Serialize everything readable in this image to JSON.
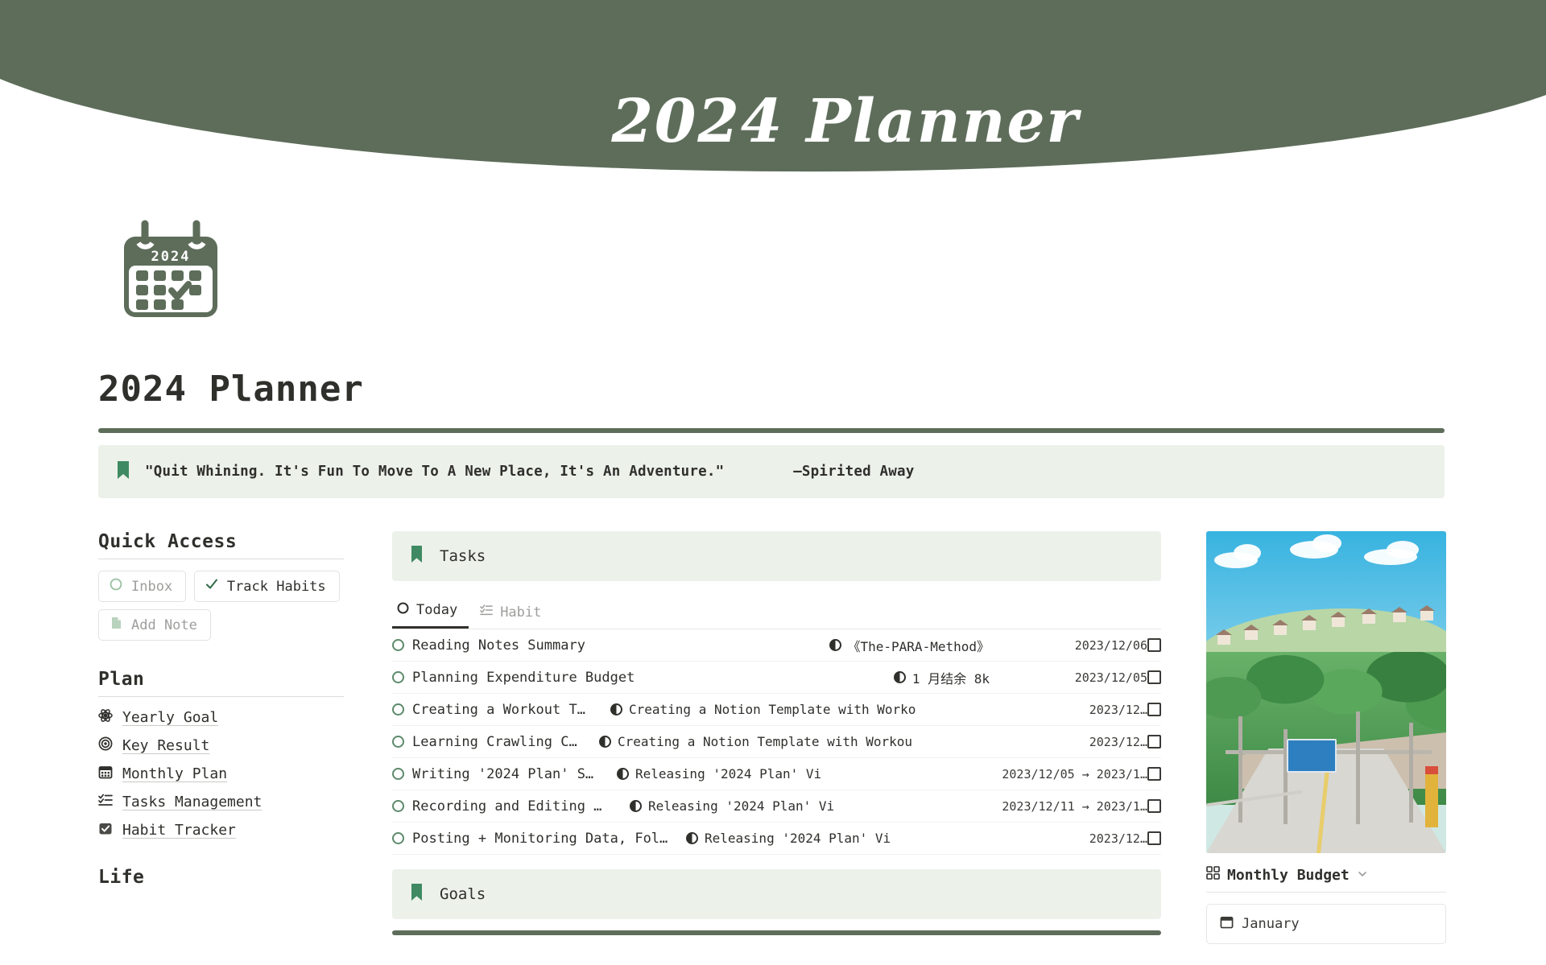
{
  "banner": {
    "title": "2024 Planner",
    "bg_color": "#5d6d5a"
  },
  "header": {
    "page_title": "2024 Planner",
    "calendar_icon_year": "2024"
  },
  "quote": {
    "text": "\"Quit Whining. It's Fun To Move To A New Place, It's An Adventure.\"        —Spirited Away",
    "bg_color": "#ecf1ea"
  },
  "sidebar": {
    "quick_access": {
      "heading": "Quick Access",
      "items": [
        {
          "label": "Inbox",
          "icon": "circle-outline-icon",
          "state": "muted"
        },
        {
          "label": "Track Habits",
          "icon": "check-icon",
          "state": "strong"
        },
        {
          "label": "Add Note",
          "icon": "document-icon",
          "state": "muted"
        }
      ]
    },
    "plan": {
      "heading": "Plan",
      "items": [
        {
          "label": "Yearly Goal",
          "icon": "atom-icon"
        },
        {
          "label": "Key Result",
          "icon": "target-icon"
        },
        {
          "label": "Monthly Plan",
          "icon": "calendar-icon"
        },
        {
          "label": "Tasks Management",
          "icon": "checklist-icon"
        },
        {
          "label": "Habit Tracker",
          "icon": "checkbox-filled-icon"
        }
      ]
    },
    "life": {
      "heading": "Life"
    }
  },
  "tasks_panel": {
    "title": "Tasks",
    "icon": "bookmark-icon",
    "tabs": [
      {
        "label": "Today",
        "icon": "circle-outline-icon",
        "active": true
      },
      {
        "label": "Habit",
        "icon": "checklist-icon",
        "active": false
      }
    ],
    "rows": [
      {
        "name": "Reading Notes Summary",
        "related": "《The-PARA-Method》",
        "date": "2023/12/06"
      },
      {
        "name": "Planning Expenditure Budget",
        "related": "1 月结余 8k",
        "date": "2023/12/05"
      },
      {
        "name": "Creating a Workout T…",
        "related": "Creating a Notion Template with Worko",
        "date": "2023/12…"
      },
      {
        "name": "Learning Crawling C…",
        "related": "Creating a Notion Template with Workou",
        "date": "2023/12…"
      },
      {
        "name": "Writing '2024 Plan' S…",
        "related": "Releasing '2024 Plan' Vi",
        "date": "2023/12/05 → 2023/1…"
      },
      {
        "name": "Recording and Editing …",
        "related": "Releasing '2024 Plan' Vi",
        "date": "2023/12/11 → 2023/1…"
      },
      {
        "name": "Posting + Monitoring Data, Fol…",
        "related": "Releasing '2024 Plan' Vi",
        "date": "2023/12…"
      }
    ]
  },
  "goals_panel": {
    "title": "Goals",
    "icon": "bookmark-icon"
  },
  "right": {
    "budget": {
      "heading": "Monthly Budget",
      "grid_icon": "grid-icon",
      "chevron": "chevron-down-icon",
      "month": "January",
      "month_icon": "calendar-icon"
    }
  }
}
